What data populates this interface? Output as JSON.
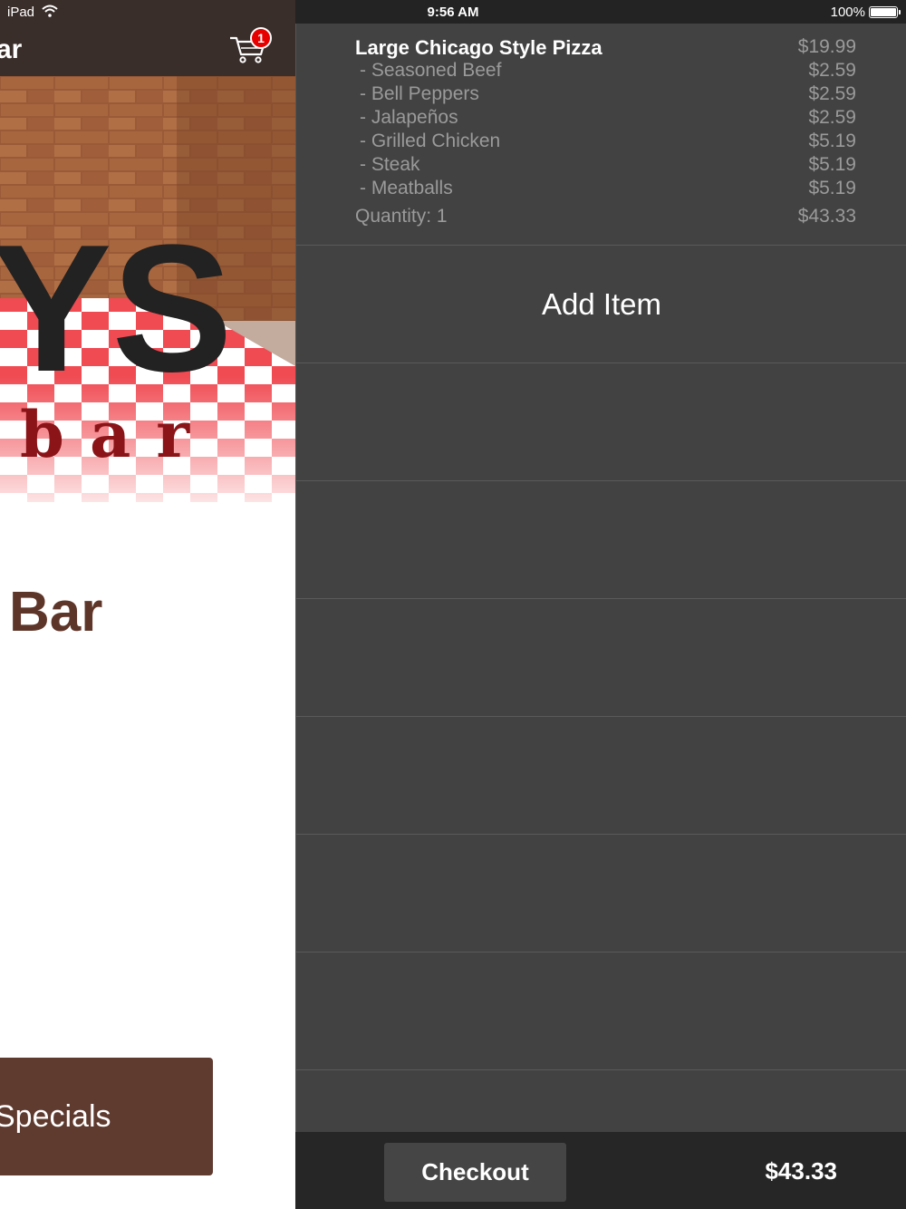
{
  "status_bar": {
    "carrier": "iPad",
    "time": "9:56 AM",
    "battery": "100%"
  },
  "left": {
    "nav_title_fragment": "ar",
    "cart_badge_count": "1",
    "logo_letters": "YS",
    "logo_subtitle": "bar",
    "heading_fragment": "Bar",
    "specials_label": "Specials"
  },
  "cart": {
    "item": {
      "title": "Large Chicago Style Pizza",
      "title_price": "$19.99",
      "modifiers": [
        {
          "name": "- Seasoned Beef",
          "price": "$2.59"
        },
        {
          "name": "- Bell Peppers",
          "price": "$2.59"
        },
        {
          "name": "- Jalapeños",
          "price": "$2.59"
        },
        {
          "name": "- Grilled Chicken",
          "price": "$5.19"
        },
        {
          "name": "- Steak",
          "price": "$5.19"
        },
        {
          "name": "- Meatballs",
          "price": "$5.19"
        }
      ],
      "quantity_label": "Quantity: 1",
      "line_total": "$43.33"
    },
    "add_item_label": "Add Item",
    "checkout_label": "Checkout",
    "total": "$43.33"
  },
  "colors": {
    "panel_bg": "#424242",
    "bottom_bar_bg": "#262626",
    "nav_brown": "#3a2e2a",
    "button_brown": "#5f3a2f",
    "heading_brown": "#5e3529",
    "badge_red": "#e60000"
  }
}
